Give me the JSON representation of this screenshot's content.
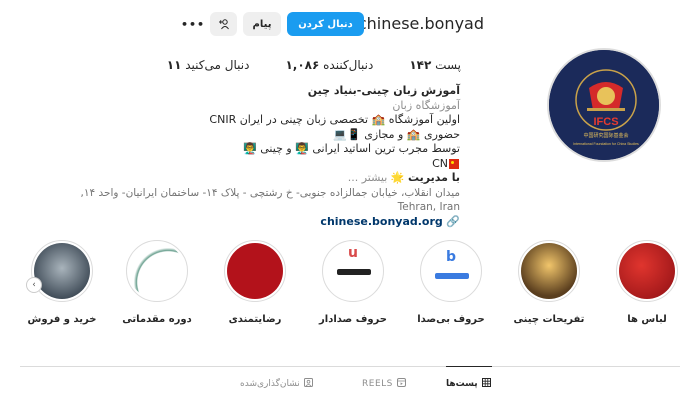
{
  "header": {
    "username": "chinese.bonyad",
    "follow_label": "دنبال کردن",
    "message_label": "پیام",
    "more_label": "•••"
  },
  "stats": {
    "posts_count": "۱۴۲",
    "posts_label": "پست",
    "followers_count": "۱,۰۸۶",
    "followers_label": "دنبال‌کننده",
    "following_count": "۱۱",
    "following_label": "دنبال می‌کنید"
  },
  "bio": {
    "title": "آموزش زبان چینی-بنیاد چین",
    "category": "آموزشگاه زبان",
    "line1": "اولین آموزشگاه 🏫 تخصصی زبان چینی در ایران CNIR",
    "line2": "حضوری 🏫 و مجازی 📱💻",
    "line3": "توسط مجرب ترین اساتید ایرانی 👨‍🏫 و چینی 👨‍🏫",
    "line3b": "CN",
    "line4": "با مدیریت 🌟 ... بیشتر",
    "line4_text": "با مدیریت",
    "more_text": "بیشتر ...",
    "address": "میدان انقلاب، خیابان جمالزاده جنوبی- خ رشتچی - پلاک ۱۴- ساختمان ایرانیان- واحد ۱۴, Tehran, Iran",
    "link": "chinese.bonyad.org"
  },
  "avatar": {
    "logo_text": "IFCS",
    "sub_text": "中国研究国际基金会",
    "caption": "International Foundation for China Studies"
  },
  "highlights": [
    {
      "label": "لباس ها",
      "color": "#b3121b"
    },
    {
      "label": "تفریحات چینی",
      "color": "#7a5a2e"
    },
    {
      "label": "حروف بی‌صدا",
      "color": "#ffffff"
    },
    {
      "label": "حروف صدادار",
      "color": "#ffffff"
    },
    {
      "label": "رضایتمندی",
      "color": "#b3121b"
    },
    {
      "label": "دوره مقدماتی",
      "color": "#ffffff"
    },
    {
      "label": "خرید و فروش",
      "color": "#4a5a6a"
    }
  ],
  "tabs": {
    "posts": "پست‌ها",
    "reels": "REELS",
    "tagged": "نشان‌گذاری‌شده"
  },
  "colors": {
    "accent": "#1a9cf0",
    "link": "#00376b",
    "muted": "#8e8e8e"
  }
}
